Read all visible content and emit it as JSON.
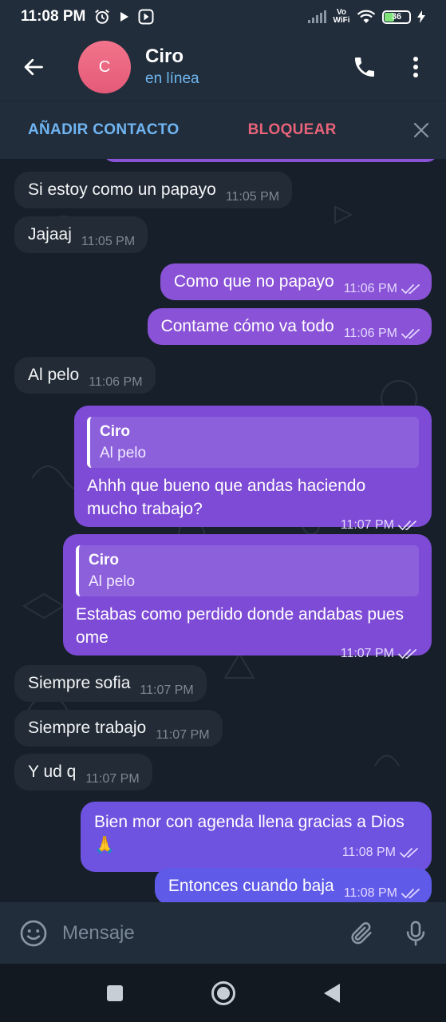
{
  "status_bar": {
    "time": "11:08 PM",
    "network_label": "Vo WiFi",
    "battery_level": "36",
    "icons": [
      "alarm-icon",
      "play-icon",
      "media-icon",
      "signal-icon",
      "wifi-icon",
      "battery-icon",
      "charging-icon"
    ]
  },
  "header": {
    "avatar_letter": "C",
    "contact_name": "Ciro",
    "status": "en línea",
    "icons": [
      "back-arrow-icon",
      "phone-icon",
      "more-vert-icon"
    ]
  },
  "action_bar": {
    "add_label": "AÑADIR CONTACTO",
    "block_label": "BLOQUEAR"
  },
  "messages": [
    {
      "dir": "in",
      "text": "Si estoy como un papayo",
      "time": "11:05 PM"
    },
    {
      "dir": "in",
      "text": "Jajaaj",
      "time": "11:05 PM"
    },
    {
      "dir": "out",
      "text": "Como que no papayo",
      "time": "11:06 PM",
      "read": true
    },
    {
      "dir": "out",
      "text": "Contame cómo va todo",
      "time": "11:06 PM",
      "read": true
    },
    {
      "dir": "in",
      "text": "Al pelo",
      "time": "11:06 PM"
    },
    {
      "dir": "out",
      "reply_to": {
        "name": "Ciro",
        "text": "Al pelo"
      },
      "text": "Ahhh que bueno que andas haciendo mucho trabajo?",
      "time": "11:07 PM",
      "read": true
    },
    {
      "dir": "out",
      "reply_to": {
        "name": "Ciro",
        "text": "Al pelo"
      },
      "text": "Estabas como perdido donde andabas pues ome",
      "time": "11:07 PM",
      "read": true
    },
    {
      "dir": "in",
      "text": "Siempre sofia",
      "time": "11:07 PM"
    },
    {
      "dir": "in",
      "text": "Siempre trabajo",
      "time": "11:07 PM"
    },
    {
      "dir": "in",
      "text": "Y ud q",
      "time": "11:07 PM"
    },
    {
      "dir": "out",
      "text": "Bien mor con agenda llena gracias a Dios 🙏",
      "time": "11:08 PM",
      "read": true
    },
    {
      "dir": "out",
      "text": "Entonces cuando baja",
      "time": "11:08 PM",
      "read": true
    }
  ],
  "input": {
    "placeholder": "Mensaje",
    "icons": [
      "emoji-icon",
      "attach-icon",
      "mic-icon"
    ]
  },
  "nav": {
    "icons": [
      "recents-square-icon",
      "home-circle-icon",
      "back-triangle-icon"
    ]
  },
  "colors": {
    "bar_bg": "#212d3b",
    "chat_bg": "#17202a",
    "incoming_bubble": "#232c36",
    "outgoing_gradient": [
      "#8a52d6",
      "#5f5ae8"
    ],
    "link_blue": "#70b5f2",
    "block_red": "#e8637a",
    "avatar_pink": "#ec6681"
  }
}
